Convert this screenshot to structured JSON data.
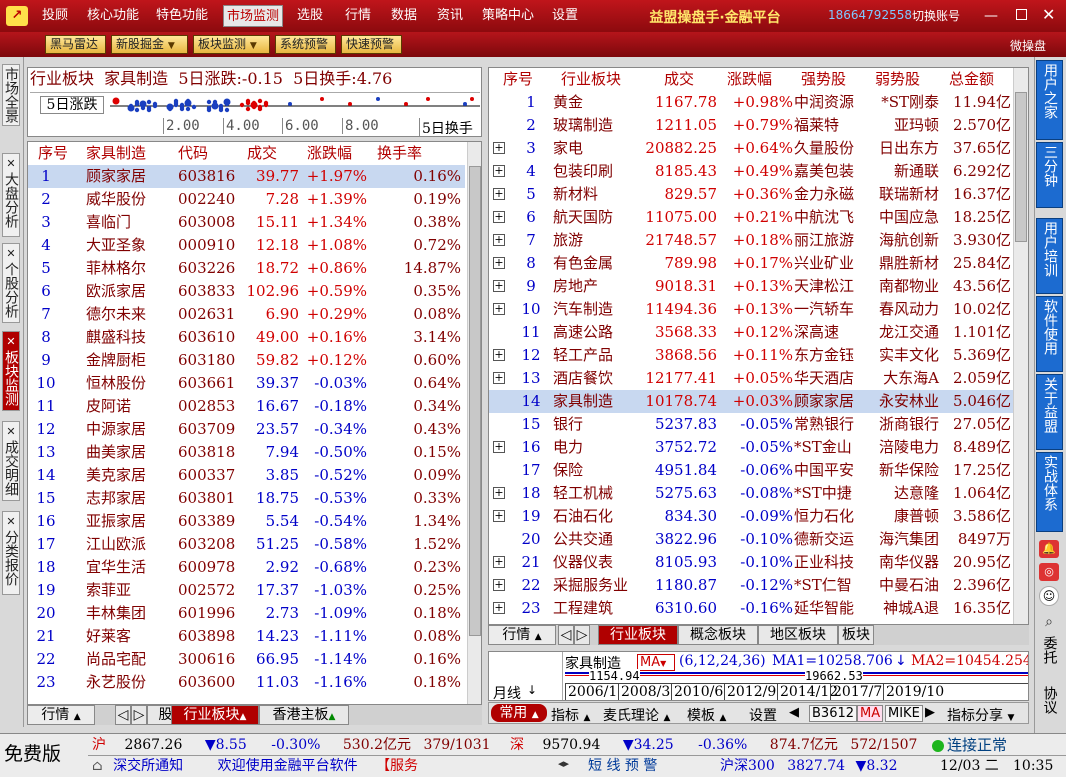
{
  "menus": [
    "投顾",
    "核心功能",
    "特色功能",
    "市场监测",
    "选股",
    "行情",
    "数据",
    "资讯",
    "策略中心",
    "设置"
  ],
  "app_title": "益盟操盘手·金融平台",
  "phone": "18664792558",
  "switch_account": "切换账号",
  "toolbar": [
    "黑马雷达",
    "新股掘金",
    "板块监测",
    "系统预警",
    "快速预警"
  ],
  "toolbar_right": "微操盘",
  "left_tabs": [
    "市场全景",
    "大盘分析",
    "个股分析",
    "板块监测",
    "成交明细",
    "分类报价"
  ],
  "right_tabs": [
    "用户之家",
    "三分钟",
    "用户培训",
    "软件使用",
    "关于益盟",
    "实战体系",
    "委托",
    "协议"
  ],
  "header_line": "行业板块  家具制造  5日涨跌:-0.15  5日换手:4.76",
  "scatter": {
    "label": "5日涨跌",
    "ticks": [
      "2.00",
      "4.00",
      "6.00",
      "8.00"
    ],
    "xlabel": "5日换手"
  },
  "stock_headers": [
    "序号",
    "家具制造",
    "代码",
    "成交",
    "涨跌幅",
    "换手率"
  ],
  "stocks": [
    [
      "1",
      "顾家家居",
      "603816",
      "39.77",
      "+1.97%",
      "0.16%"
    ],
    [
      "2",
      "威华股份",
      "002240",
      "7.28",
      "+1.39%",
      "0.19%"
    ],
    [
      "3",
      "喜临门",
      "603008",
      "15.11",
      "+1.34%",
      "0.38%"
    ],
    [
      "4",
      "大亚圣象",
      "000910",
      "12.18",
      "+1.08%",
      "0.72%"
    ],
    [
      "5",
      "菲林格尔",
      "603226",
      "18.72",
      "+0.86%",
      "14.87%"
    ],
    [
      "6",
      "欧派家居",
      "603833",
      "102.96",
      "+0.59%",
      "0.35%"
    ],
    [
      "7",
      "德尔未来",
      "002631",
      "6.90",
      "+0.29%",
      "0.08%"
    ],
    [
      "8",
      "麒盛科技",
      "603610",
      "49.00",
      "+0.16%",
      "3.14%"
    ],
    [
      "9",
      "金牌厨柜",
      "603180",
      "59.82",
      "+0.12%",
      "0.60%"
    ],
    [
      "10",
      "恒林股份",
      "603661",
      "39.37",
      "-0.03%",
      "0.64%"
    ],
    [
      "11",
      "皮阿诺",
      "002853",
      "16.67",
      "-0.18%",
      "0.34%"
    ],
    [
      "12",
      "中源家居",
      "603709",
      "23.57",
      "-0.34%",
      "0.43%"
    ],
    [
      "13",
      "曲美家居",
      "603818",
      "7.94",
      "-0.50%",
      "0.15%"
    ],
    [
      "14",
      "美克家居",
      "600337",
      "3.85",
      "-0.52%",
      "0.09%"
    ],
    [
      "15",
      "志邦家居",
      "603801",
      "18.75",
      "-0.53%",
      "0.33%"
    ],
    [
      "16",
      "亚振家居",
      "603389",
      "5.54",
      "-0.54%",
      "1.34%"
    ],
    [
      "17",
      "江山欧派",
      "603208",
      "51.25",
      "-0.58%",
      "1.52%"
    ],
    [
      "18",
      "宜华生活",
      "600978",
      "2.92",
      "-0.68%",
      "0.23%"
    ],
    [
      "19",
      "索菲亚",
      "002572",
      "17.37",
      "-1.03%",
      "0.25%"
    ],
    [
      "20",
      "丰林集团",
      "601996",
      "2.73",
      "-1.09%",
      "0.18%"
    ],
    [
      "21",
      "好莱客",
      "603898",
      "14.23",
      "-1.11%",
      "0.08%"
    ],
    [
      "22",
      "尚品宅配",
      "300616",
      "66.95",
      "-1.14%",
      "0.16%"
    ],
    [
      "23",
      "永艺股份",
      "603600",
      "11.03",
      "-1.16%",
      "0.18%"
    ]
  ],
  "sector_headers": [
    "序号",
    "行业板块",
    "成交",
    "涨跌幅",
    "强势股",
    "弱势股",
    "总金额"
  ],
  "sectors": [
    [
      "1",
      "黄金",
      "1167.78",
      "+0.98%",
      "中润资源",
      "*ST刚泰",
      "11.94亿",
      false
    ],
    [
      "2",
      "玻璃制造",
      "1211.05",
      "+0.79%",
      "福莱特",
      "亚玛顿",
      "2.570亿",
      false
    ],
    [
      "3",
      "家电",
      "20882.25",
      "+0.64%",
      "久量股份",
      "日出东方",
      "37.65亿",
      true
    ],
    [
      "4",
      "包装印刷",
      "8185.43",
      "+0.49%",
      "嘉美包装",
      "新通联",
      "6.292亿",
      true
    ],
    [
      "5",
      "新材料",
      "829.57",
      "+0.36%",
      "金力永磁",
      "联瑞新材",
      "16.37亿",
      true
    ],
    [
      "6",
      "航天国防",
      "11075.00",
      "+0.21%",
      "中航沈飞",
      "中国应急",
      "18.25亿",
      true
    ],
    [
      "7",
      "旅游",
      "21748.57",
      "+0.18%",
      "丽江旅游",
      "海航创新",
      "3.930亿",
      true
    ],
    [
      "8",
      "有色金属",
      "789.98",
      "+0.17%",
      "兴业矿业",
      "鼎胜新材",
      "25.84亿",
      true
    ],
    [
      "9",
      "房地产",
      "9018.31",
      "+0.13%",
      "天津松江",
      "南都物业",
      "43.56亿",
      true
    ],
    [
      "10",
      "汽车制造",
      "11494.36",
      "+0.13%",
      "一汽轿车",
      "春风动力",
      "10.02亿",
      true
    ],
    [
      "11",
      "高速公路",
      "3568.33",
      "+0.12%",
      "深高速",
      "龙江交通",
      "1.101亿",
      false
    ],
    [
      "12",
      "轻工产品",
      "3868.56",
      "+0.11%",
      "东方金钰",
      "实丰文化",
      "5.369亿",
      true
    ],
    [
      "13",
      "酒店餐饮",
      "12177.41",
      "+0.05%",
      "华天酒店",
      "大东海A",
      "2.059亿",
      true
    ],
    [
      "14",
      "家具制造",
      "10178.74",
      "+0.03%",
      "顾家家居",
      "永安林业",
      "5.046亿",
      false
    ],
    [
      "15",
      "银行",
      "5237.83",
      "-0.05%",
      "常熟银行",
      "浙商银行",
      "27.05亿",
      false
    ],
    [
      "16",
      "电力",
      "3752.72",
      "-0.05%",
      "*ST金山",
      "涪陵电力",
      "8.489亿",
      true
    ],
    [
      "17",
      "保险",
      "4951.84",
      "-0.06%",
      "中国平安",
      "新华保险",
      "17.25亿",
      false
    ],
    [
      "18",
      "轻工机械",
      "5275.63",
      "-0.08%",
      "*ST中捷",
      "达意隆",
      "1.064亿",
      true
    ],
    [
      "19",
      "石油石化",
      "834.30",
      "-0.09%",
      "恒力石化",
      "康普顿",
      "3.586亿",
      true
    ],
    [
      "20",
      "公共交通",
      "3822.96",
      "-0.10%",
      "德新交运",
      "海汽集团",
      "8497万",
      false
    ],
    [
      "21",
      "仪器仪表",
      "8105.93",
      "-0.10%",
      "正业科技",
      "南华仪器",
      "20.95亿",
      true
    ],
    [
      "22",
      "采掘服务业",
      "1180.87",
      "-0.12%",
      "*ST仁智",
      "中曼石油",
      "2.396亿",
      true
    ],
    [
      "23",
      "工程建筑",
      "6310.60",
      "-0.16%",
      "延华智能",
      "神城A退",
      "16.35亿",
      true
    ]
  ],
  "left_bottom_tabs": [
    "行情",
    "股",
    "行业板块",
    "香港主板"
  ],
  "right_bottom_tabs": [
    "行情",
    "行业板块",
    "概念板块",
    "地区板块",
    "板块"
  ],
  "mini_chart": {
    "name": "家具制造",
    "ind": "MA",
    "params": "(6,12,24,36)",
    "ma1": "MA1=10258.706",
    "ma2": "MA2=10454.254",
    "v1": "1154.94",
    "v2": "19662.53",
    "period": "月线",
    "dates": [
      "2006/1",
      "2008/3",
      "2010/6",
      "2012/9",
      "2014/12",
      "2017/7",
      "2019/10"
    ]
  },
  "func_bar": [
    "常用",
    "指标",
    "麦氏理论",
    "模板",
    "设置",
    "B3612",
    "MA",
    "MIKE",
    "指标分享"
  ],
  "free_version": "免费版",
  "index1": {
    "name": "沪",
    "value": "2867.26",
    "chg": "▼8.55",
    "pct": "-0.30%",
    "amt": "530.2亿元",
    "ratio": "379/1031"
  },
  "index2": {
    "name": "深",
    "value": "9570.94",
    "chg": "▼34.25",
    "pct": "-0.36%",
    "amt": "874.7亿元",
    "ratio": "572/1507"
  },
  "conn": "连接正常",
  "news1": "深交所通知",
  "news2": "欢迎使用金融平台软件",
  "news3": "【服务",
  "warning": "短 线 预 警",
  "index3": {
    "name": "沪深300",
    "value": "3827.74",
    "chg": "▼8.32"
  },
  "date": "12/03 二",
  "time": "10:35",
  "colors": {
    "menu_red": "#b5151b",
    "up": "#d00000",
    "down": "#0000c8",
    "name": "#800000"
  }
}
